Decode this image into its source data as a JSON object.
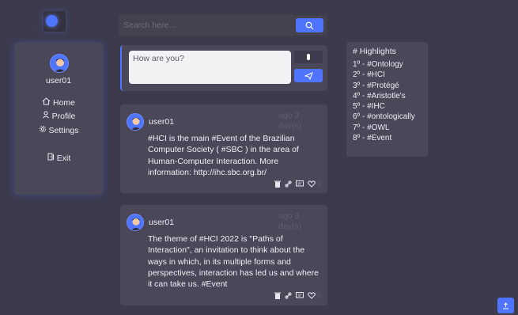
{
  "user": {
    "name": "user01"
  },
  "nav": [
    {
      "label": "Home",
      "icon": "home-icon"
    },
    {
      "label": "Profile",
      "icon": "profile-icon"
    },
    {
      "label": "Settings",
      "icon": "gear-icon"
    },
    {
      "label": "Exit",
      "icon": "exit-icon"
    }
  ],
  "search": {
    "placeholder": "Search here..."
  },
  "compose": {
    "placeholder": "How are you?"
  },
  "posts": [
    {
      "user": "user01",
      "time": "ago 3 day(s)",
      "text": "#HCI is the main #Event of the Brazilian Computer Society ( #SBC ) in the area of Human-Computer Interaction. More information: http://ihc.sbc.org.br/",
      "likes": "0"
    },
    {
      "user": "user01",
      "time": "ago 3 day(s)",
      "text": "The theme of #HCI 2022 is \"Paths of Interaction\", an invitation to think about the ways in which, in its multiple forms and perspectives, interaction has led us and where it can take us. #Event",
      "likes": "0"
    }
  ],
  "highlights": {
    "title": "# Highlights",
    "items": [
      "1º - #Ontology",
      "2º - #HCI",
      "3º - #Protégé",
      "4º - #Aristotle's",
      "5º - #IHC",
      "6º - #ontologically",
      "7º - #OWL",
      "8º - #Event"
    ]
  },
  "colors": {
    "background": "#3c3a4b",
    "card": "#4a4758",
    "accent": "#4f74ff",
    "muted_text": "#5f5d70"
  }
}
